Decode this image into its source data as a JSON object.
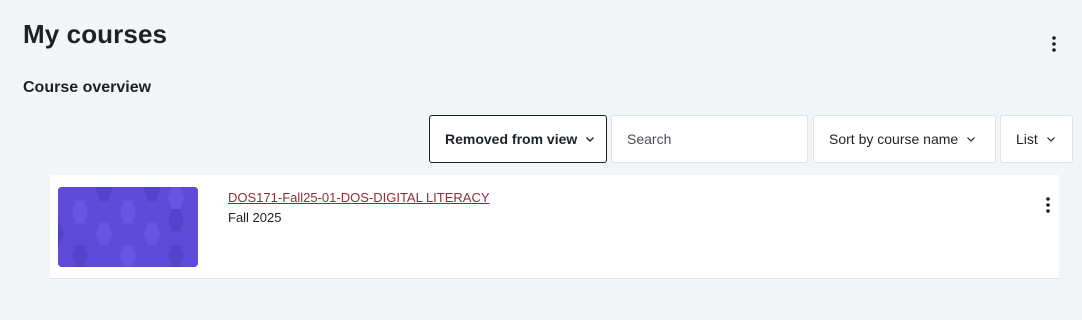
{
  "header": {
    "title": "My courses",
    "menu_icon": "kebab-vertical-icon"
  },
  "course_overview": {
    "title": "Course overview",
    "filter": {
      "label": "Removed from view",
      "icon": "chevron-down-icon"
    },
    "search": {
      "placeholder": "Search",
      "value": ""
    },
    "sort": {
      "label": "Sort by course name",
      "icon": "chevron-down-icon"
    },
    "view": {
      "label": "List",
      "icon": "chevron-down-icon"
    }
  },
  "courses": [
    {
      "name": "DOS171-Fall25-01-DOS-DIGITAL LITERACY",
      "term": "Fall 2025",
      "image_color": "#5f4bd8",
      "menu_icon": "kebab-vertical-icon"
    }
  ],
  "colors": {
    "background": "#f3f6f9",
    "link": "#8c2d3d",
    "text": "#1d2125",
    "border": "#dee2e6"
  }
}
